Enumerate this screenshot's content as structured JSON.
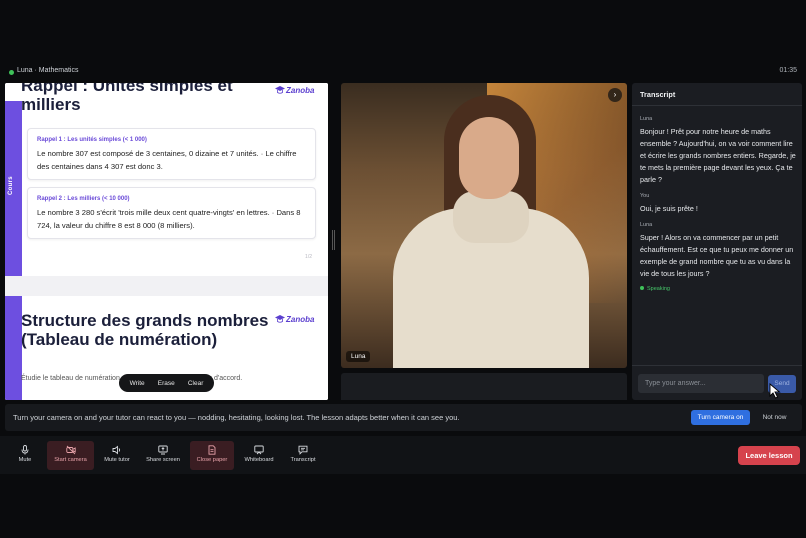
{
  "header": {
    "title": "Luna · Mathematics",
    "timer": "01:35"
  },
  "slides": {
    "slide1": {
      "title": "Rappel : Unités simples et milliers",
      "side_label": "Cours",
      "logo": "Zanoba",
      "cards": [
        {
          "heading": "Rappel 1 : Les unités simples (< 1 000)",
          "text": "Le nombre 307 est composé de 3 centaines, 0 dizaine et 7 unités. · Le chiffre des centaines dans 4 307 est donc 3."
        },
        {
          "heading": "Rappel 2 : Les milliers (< 10 000)",
          "text": "Le nombre 3 280 s'écrit 'trois mille deux cent quatre-vingts' en lettres. · Dans 8 724, la valeur du chiffre 8 est 8 000 (8 milliers)."
        }
      ],
      "page": "1/2"
    },
    "slide2": {
      "title": "Structure des grands nombres (Tableau de numération)",
      "logo": "Zanoba",
      "desc": "Étudie le tableau de numération et les règles orthographiques d'accord."
    },
    "toolbar": {
      "write": "Write",
      "erase": "Erase",
      "clear": "Clear"
    }
  },
  "video": {
    "name": "Luna",
    "expand_glyph": "›"
  },
  "transcript": {
    "title": "Transcript",
    "messages": [
      {
        "who": "Luna",
        "text": "Bonjour ! Prêt pour notre heure de maths ensemble ? Aujourd'hui, on va voir comment lire et écrire les grands nombres entiers. Regarde, je te mets la première page devant les yeux. Ça te parle ?"
      },
      {
        "who": "You",
        "text": "Oui, je suis prête !"
      },
      {
        "who": "Luna",
        "text": "Super ! Alors on va commencer par un petit échauffement. Est ce que tu peux me donner un exemple de grand nombre que tu as vu dans la vie de tous les jours ?"
      }
    ],
    "status": "Speaking",
    "input_placeholder": "Type your answer...",
    "send_label": "Send"
  },
  "notice": {
    "text": "Turn your camera on and your tutor can react to you — nodding, hesitating, looking lost. The lesson adapts better when it can see you.",
    "turn_on": "Turn camera on",
    "not_now": "Not now"
  },
  "controls": {
    "mute": "Mute",
    "start_camera": "Start camera",
    "mute_tutor": "Mute tutor",
    "share_screen": "Share screen",
    "close_paper": "Close paper",
    "whiteboard": "Whiteboard",
    "transcript": "Transcript",
    "leave": "Leave lesson"
  },
  "colors": {
    "accent_purple": "#6d4fe0",
    "primary_blue": "#2f6fe0",
    "leave_red": "#d6434d",
    "speaking_green": "#3fc35a"
  }
}
